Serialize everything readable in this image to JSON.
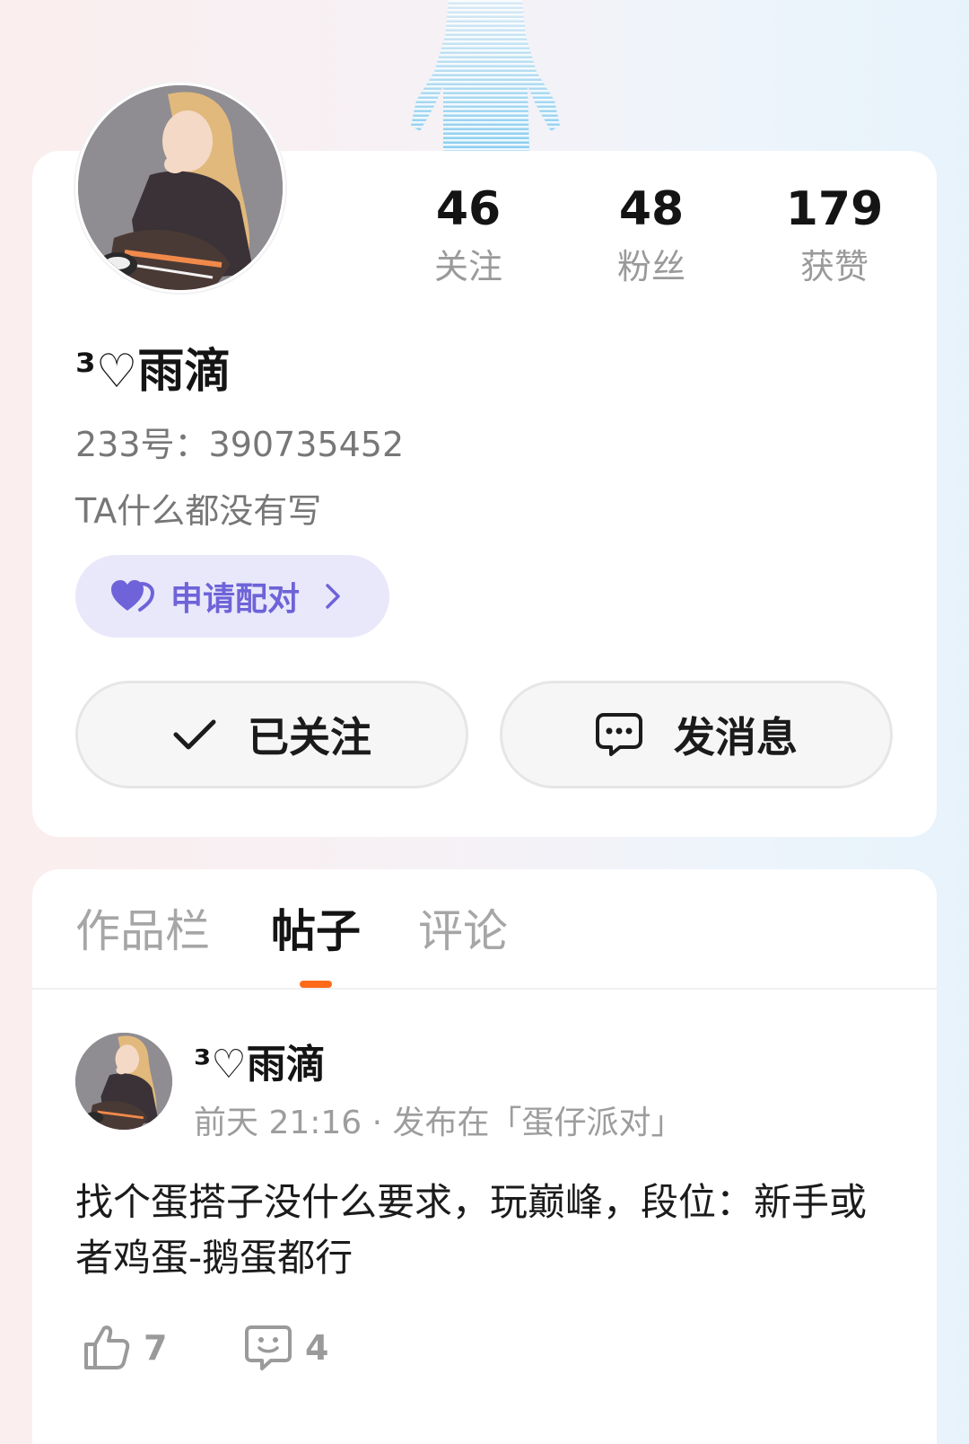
{
  "profile": {
    "nickname": "³♡雨滴",
    "uid_line": "233号：390735452",
    "bio": "TA什么都没有写",
    "stats": [
      {
        "value": "46",
        "label": "关注"
      },
      {
        "value": "48",
        "label": "粉丝"
      },
      {
        "value": "179",
        "label": "获赞"
      }
    ],
    "pair_button": "申请配对",
    "follow_button": "已关注",
    "message_button": "发消息"
  },
  "tabs": [
    {
      "label": "作品栏",
      "active": false
    },
    {
      "label": "帖子",
      "active": true
    },
    {
      "label": "评论",
      "active": false
    }
  ],
  "post": {
    "author": "³♡雨滴",
    "meta": "前天 21:16 · 发布在「蛋仔派对」",
    "text": "找个蛋搭子没什么要求，玩巅峰，段位：新手或者鸡蛋-鹅蛋都行",
    "likes": "7",
    "comments": "4"
  },
  "colors": {
    "accent_tab": "#ff6a1a",
    "pair_text": "#6e63d8",
    "pair_bg": "#e9e8fb"
  },
  "icons": [
    "heart-pair-icon",
    "chevron-right-icon",
    "check-icon",
    "message-bubble-icon",
    "thumbs-up-icon",
    "comment-smile-icon"
  ]
}
